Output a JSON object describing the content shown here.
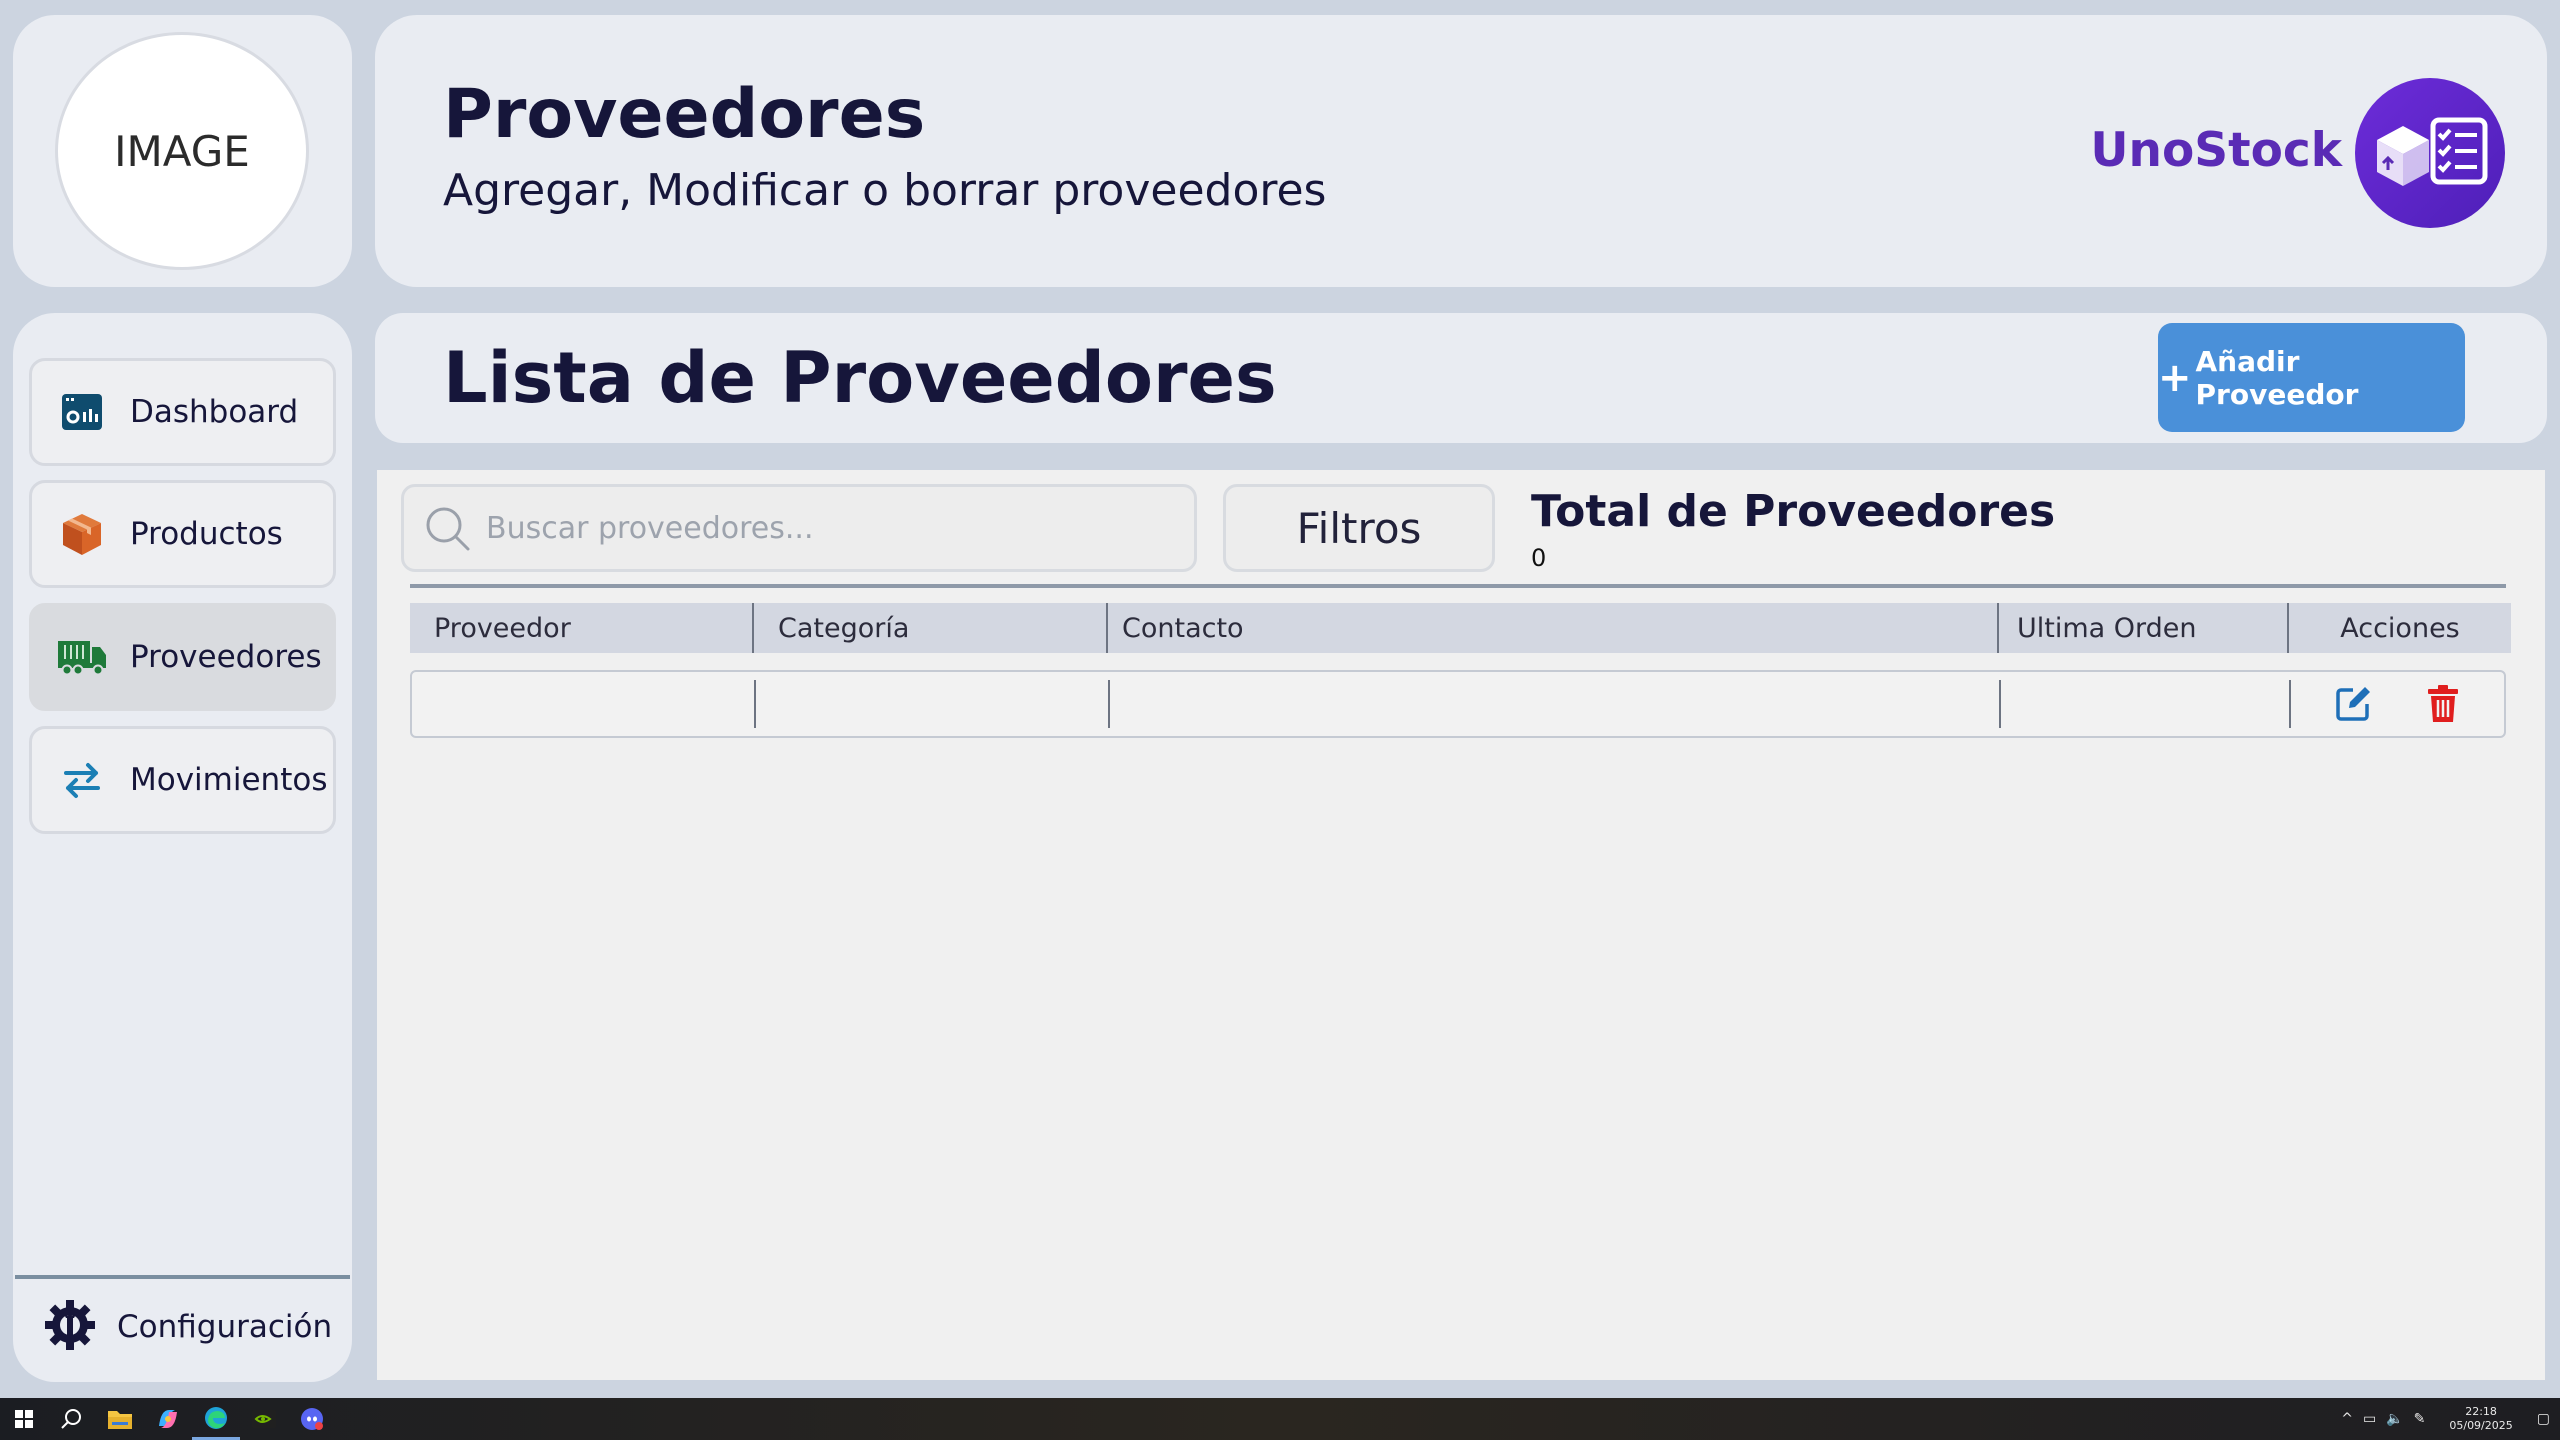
{
  "avatar": {
    "placeholder": "IMAGE"
  },
  "header": {
    "title": "Proveedores",
    "subtitle": "Agregar, Modificar o borrar proveedores",
    "brand": "UnoStock"
  },
  "sidebar": {
    "items": [
      {
        "label": "Dashboard",
        "icon": "dashboard-icon"
      },
      {
        "label": "Productos",
        "icon": "box-icon"
      },
      {
        "label": "Proveedores",
        "icon": "truck-icon",
        "active": true
      },
      {
        "label": "Movimientos",
        "icon": "swap-arrows-icon"
      }
    ],
    "settings_label": "Configuración"
  },
  "list": {
    "title": "Lista de Proveedores",
    "add_button": "Añadir Proveedor"
  },
  "toolbar": {
    "search_placeholder": "Buscar proveedores...",
    "filters_label": "Filtros",
    "total_label": "Total de Proveedores",
    "total_value": "0"
  },
  "table": {
    "columns": [
      "Proveedor",
      "Categoría",
      "Contacto",
      "Ultima Orden",
      "Acciones"
    ],
    "rows": [
      {
        "proveedor": "",
        "categoria": "",
        "contacto": "",
        "ultima_orden": ""
      }
    ]
  },
  "taskbar": {
    "time": "22:18",
    "date": "05/09/2025"
  },
  "colors": {
    "accent_purple": "#5a2bb5",
    "add_button": "#4a90d9",
    "delete_red": "#e01e1e",
    "edit_blue": "#1e6fb8",
    "background": "#ccd4e0"
  }
}
